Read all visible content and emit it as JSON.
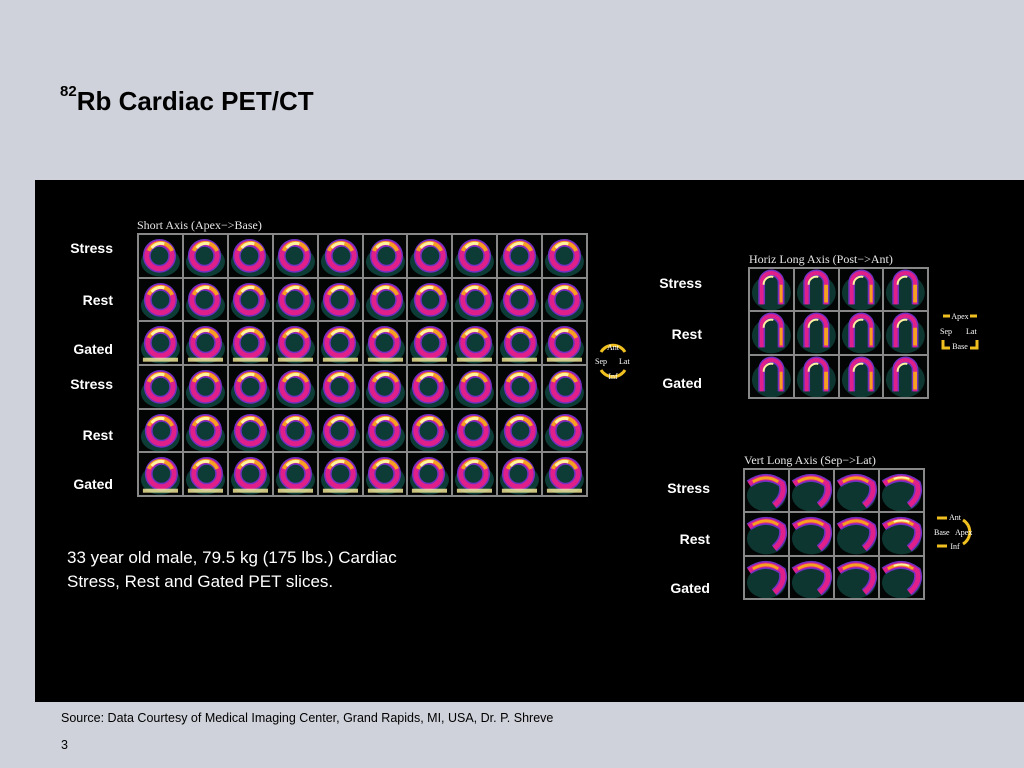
{
  "slide": {
    "title_sup": "82",
    "title_main": "Rb Cardiac PET/CT",
    "description": "33 year old male, 79.5 kg (175 lbs.) Cardiac Stress, Rest and Gated PET slices.",
    "source": "Source: Data Courtesy of Medical Imaging Center, Grand Rapids, MI, USA, Dr. P. Shreve",
    "page_number": "3"
  },
  "short_axis": {
    "title": "Short Axis (Apex−>Base)",
    "rows": [
      "Stress",
      "Rest",
      "Gated",
      "Stress",
      "Rest",
      "Gated"
    ],
    "orientation": {
      "top": "Ant",
      "left": "Sep",
      "right": "Lat",
      "bottom": "Inf"
    }
  },
  "horiz_long_axis": {
    "title": "Horiz Long Axis (Post−>Ant)",
    "rows": [
      "Stress",
      "Rest",
      "Gated"
    ],
    "orientation": {
      "top": "Apex",
      "left": "Sep",
      "right": "Lat",
      "bottom": "Base"
    }
  },
  "vert_long_axis": {
    "title": "Vert Long Axis (Sep−>Lat)",
    "rows": [
      "Stress",
      "Rest",
      "Gated"
    ],
    "orientation": {
      "top": "Ant",
      "left": "Base",
      "right": "Apex",
      "bottom": "Inf"
    }
  },
  "colors": {
    "hot": "#fff3a0",
    "warm": "#f5a020",
    "mid": "#e0208a",
    "cool": "#7030c0",
    "low": "#17685e",
    "orient_arc": "#f0c020"
  }
}
